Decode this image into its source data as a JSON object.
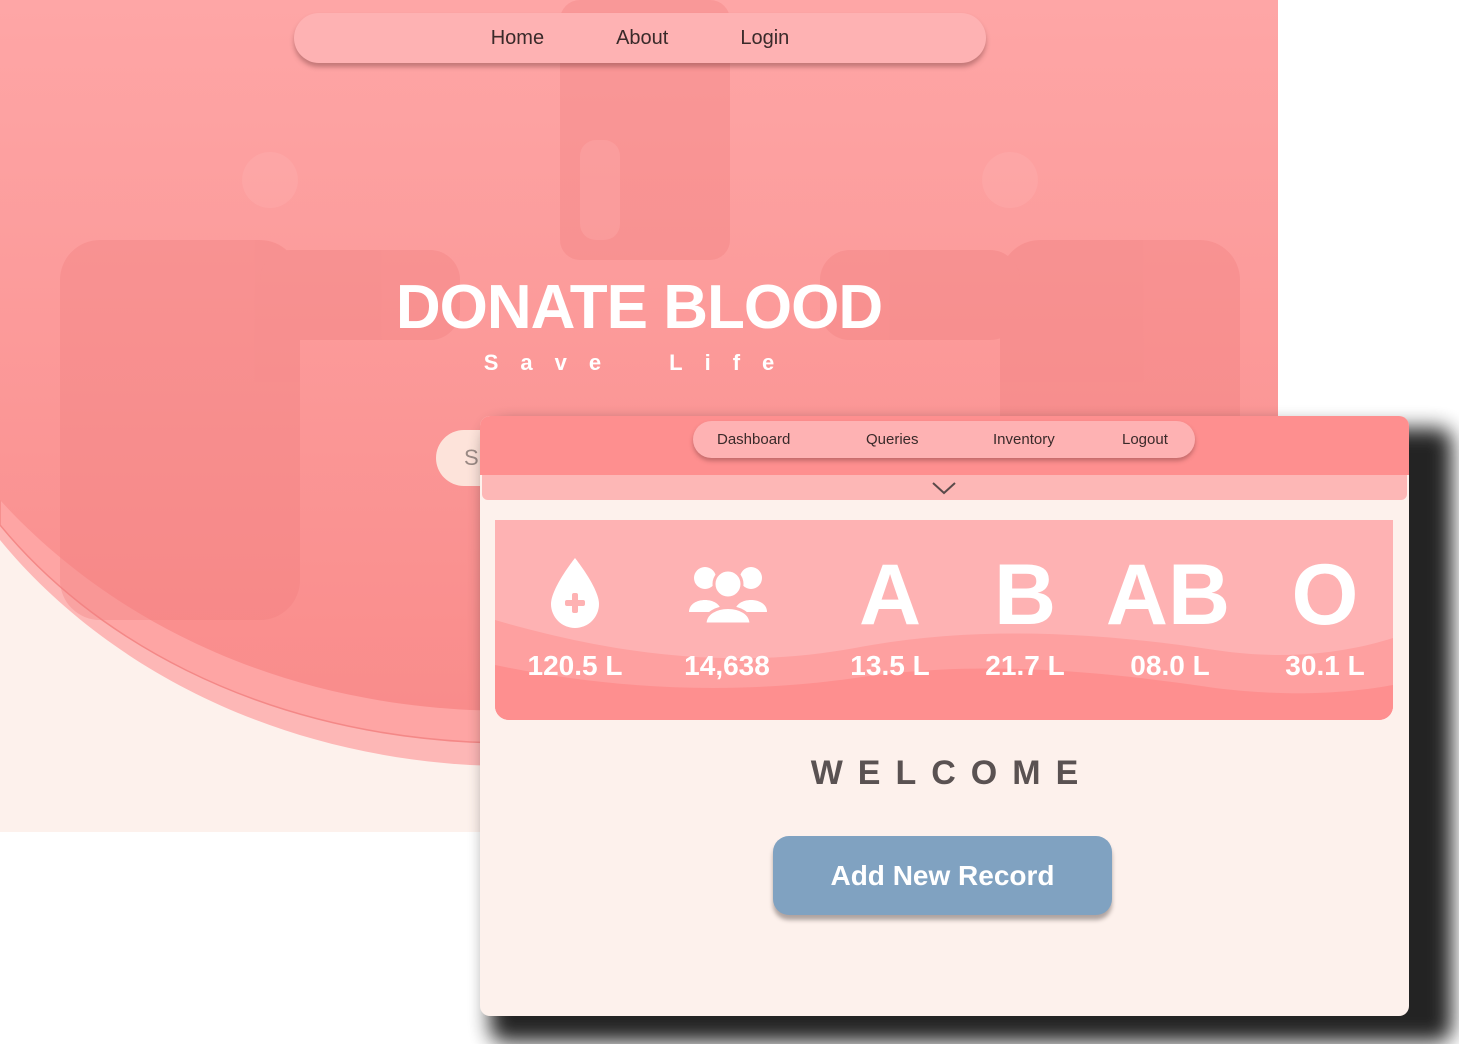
{
  "landing": {
    "nav": {
      "items": [
        "Home",
        "About",
        "Login"
      ]
    },
    "hero": {
      "title": "DONATE BLOOD",
      "subtitle": "Save Life"
    },
    "search": {
      "placeholder_visible": "S"
    }
  },
  "dashboard": {
    "nav": {
      "items": [
        "Dashboard",
        "Queries",
        "Inventory",
        "Logout"
      ]
    },
    "toggle_icon": "chevron-down-icon",
    "stats": [
      {
        "icon": "blood-drop-plus-icon",
        "value": "120.5 L"
      },
      {
        "icon": "users-group-icon",
        "value": "14,638"
      },
      {
        "label": "A",
        "value": "13.5 L"
      },
      {
        "label": "B",
        "value": "21.7 L"
      },
      {
        "label": "AB",
        "value": "08.0 L"
      },
      {
        "label": "O",
        "value": "30.1 L"
      }
    ],
    "welcome": "WELCOME",
    "add_button": "Add New Record"
  },
  "colors": {
    "primary": "#fe8f8f",
    "light": "#feb2b3",
    "background": "#fdf1ec",
    "button": "#80a2c1",
    "text_dark": "#5a5252"
  }
}
